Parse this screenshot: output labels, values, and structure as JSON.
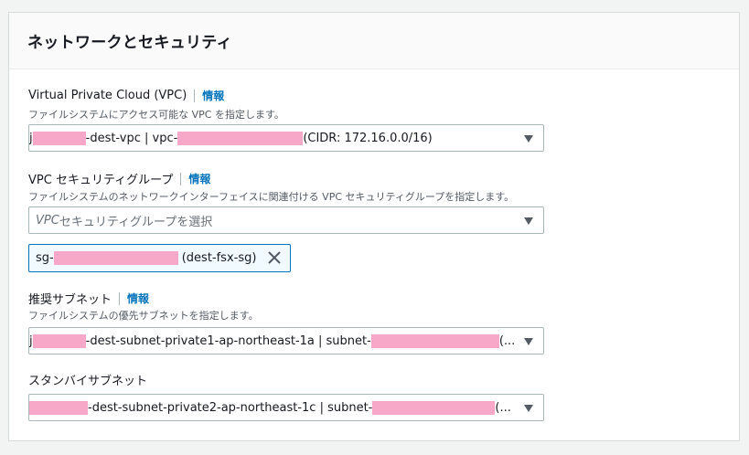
{
  "section": {
    "title": "ネットワークとセキュリティ"
  },
  "info_label": "情報",
  "vpc": {
    "label": "Virtual Private Cloud (VPC)",
    "description": "ファイルシステムにアクセス可能な VPC を指定します。",
    "prefix": "j",
    "name_suffix": "-dest-vpc | vpc-",
    "cidr": "(CIDR: 172.16.0.0/16)"
  },
  "security_group": {
    "label": "VPC セキュリティグループ",
    "description": "ファイルシステムのネットワークインターフェイスに関連付ける VPC セキュリティグループを指定します。",
    "placeholder_prefix": "VPC",
    "placeholder_rest": " セキュリティグループを選択",
    "token_prefix": "sg-",
    "token_name": "(dest-fsx-sg)"
  },
  "preferred_subnet": {
    "label": "推奨サブネット",
    "description": "ファイルシステムの優先サブネットを指定します。",
    "prefix": "j",
    "name": "-dest-subnet-private1-ap-northeast-1a | subnet-",
    "ellipsis": "(..."
  },
  "standby_subnet": {
    "label": "スタンバイサブネット",
    "name": "-dest-subnet-private2-ap-northeast-1c | subnet-",
    "ellipsis": "(..."
  },
  "colors": {
    "accent": "#0073bb",
    "redaction": "#f7a8c8",
    "border": "#aab7b8"
  },
  "icons": {
    "caret": "caret-down-icon",
    "close": "close-icon"
  }
}
